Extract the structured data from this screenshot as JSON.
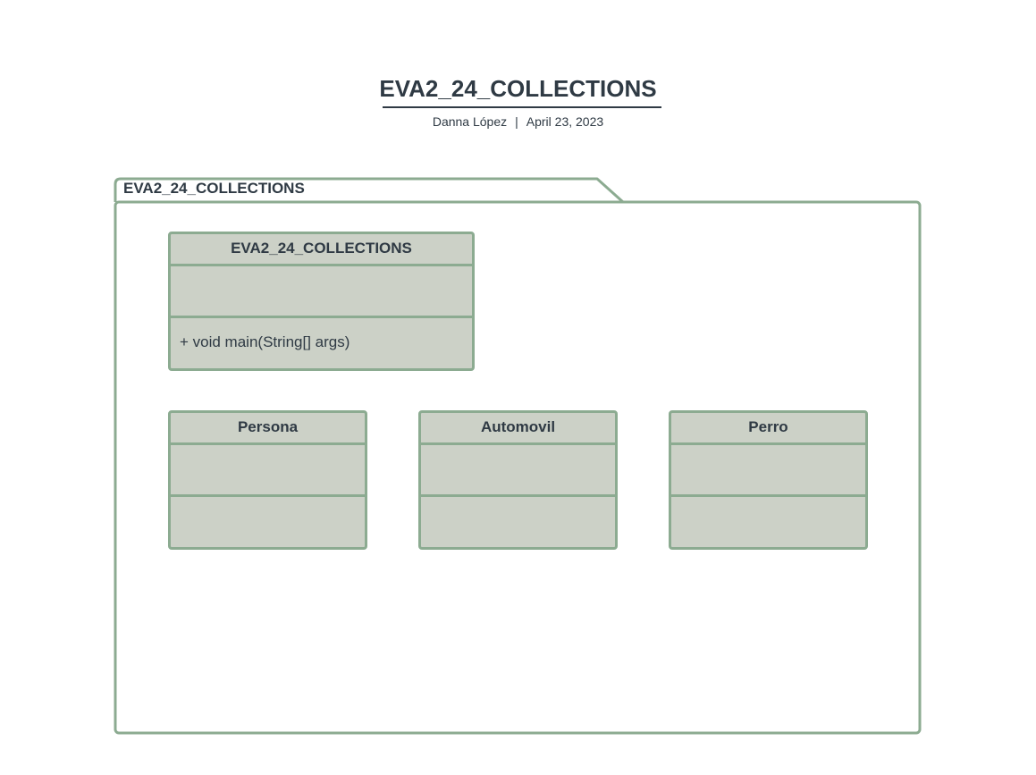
{
  "header": {
    "title": "EVA2_24_COLLECTIONS",
    "author": "Danna López",
    "separator": "|",
    "date": "April 23, 2023"
  },
  "package": {
    "name": "EVA2_24_COLLECTIONS"
  },
  "classes": [
    {
      "name": "EVA2_24_COLLECTIONS",
      "attributes": "",
      "operations": "+ void main(String[] args)"
    },
    {
      "name": "Persona",
      "attributes": "",
      "operations": ""
    },
    {
      "name": "Automovil",
      "attributes": "",
      "operations": ""
    },
    {
      "name": "Perro",
      "attributes": "",
      "operations": ""
    }
  ],
  "colors": {
    "class_fill": "#ccd1c7",
    "border": "#8cab91",
    "text": "#2f3a44"
  }
}
